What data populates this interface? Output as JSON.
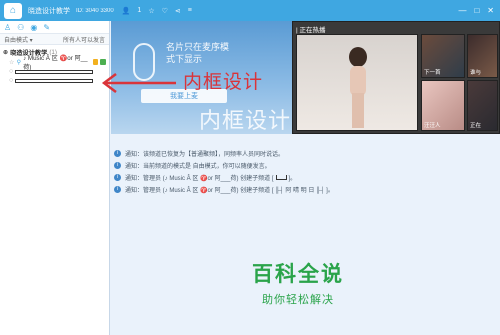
{
  "titlebar": {
    "title": "晓造设计教学",
    "room_id": "ID: 3040 3300",
    "stat": "1",
    "icons": [
      "home-icon",
      "user-icon",
      "star-icon",
      "heart-icon",
      "share-icon",
      "menu-icon"
    ]
  },
  "sidebar": {
    "toolbar_icons": [
      "people-icon",
      "group-icon",
      "location-icon",
      "edit-icon"
    ],
    "mode_label": "自由模式",
    "mode_right": "所有人可以发言",
    "root_channel": "晓造设计教学",
    "root_count": "(1)",
    "user_name": "♪ Music Â 区 ♈or 阿__荷)",
    "rows": [
      "",
      ""
    ]
  },
  "stage": {
    "msg_line1": "名片只在麦序模",
    "msg_line2": "式下显示",
    "button": "我要上麦"
  },
  "hot": {
    "title": "| 正在热播",
    "labels": [
      "下一首",
      "谁与",
      "汪汪人",
      "正在"
    ]
  },
  "annotation": {
    "text": "内框设计"
  },
  "messages": [
    {
      "prefix": "通知：",
      "text": "该频道已恢复为【普通聚频】，同频率人员同时说话。"
    },
    {
      "prefix": "通知：",
      "text": "当前频道的模式是 自由模式，你可以随便发言。"
    },
    {
      "prefix": "通知：",
      "text": "管理员 (♪ Music Â 区 ♈or 阿___荷) 创建子频道 [",
      "suffix": "]。"
    },
    {
      "prefix": "通知：",
      "text": "管理员 (♪ Music Â 区 ♈or 阿___荷) 创建子频道 [ ╟┤ 阿 晴 明 日 ╟┤ ]。",
      "suffix": ""
    }
  ],
  "watermark": "内框设计",
  "brand": {
    "name": "百科全说",
    "slogan": "助你轻松解决"
  },
  "colors": {
    "accent": "#3fa7e1",
    "annotation": "#d9343a",
    "brand": "#2aa44a"
  }
}
